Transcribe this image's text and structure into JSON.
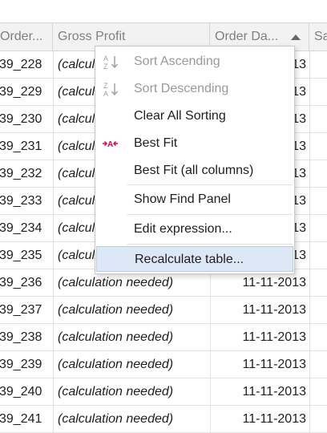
{
  "columns": {
    "col1": "Order...",
    "col2": "Gross Profit",
    "col3": "Order Da...",
    "col4": "Sa"
  },
  "rows": [
    {
      "id": "39_228",
      "gross": "(calculation needed)",
      "date": "11-11-2013"
    },
    {
      "id": "39_229",
      "gross": "(calculation needed)",
      "date": "11-11-2013"
    },
    {
      "id": "39_230",
      "gross": "(calculation needed)",
      "date": "11-11-2013"
    },
    {
      "id": "39_231",
      "gross": "(calculation needed)",
      "date": "11-11-2013"
    },
    {
      "id": "39_232",
      "gross": "(calculation needed)",
      "date": "11-11-2013"
    },
    {
      "id": "39_233",
      "gross": "(calculation needed)",
      "date": "11-11-2013"
    },
    {
      "id": "39_234",
      "gross": "(calculation needed)",
      "date": "11-11-2013"
    },
    {
      "id": "39_235",
      "gross": "(calculation needed)",
      "date": "11-11-2013"
    },
    {
      "id": "39_236",
      "gross": "(calculation needed)",
      "date": "11-11-2013"
    },
    {
      "id": "39_237",
      "gross": "(calculation needed)",
      "date": "11-11-2013"
    },
    {
      "id": "39_238",
      "gross": "(calculation needed)",
      "date": "11-11-2013"
    },
    {
      "id": "39_239",
      "gross": "(calculation needed)",
      "date": "11-11-2013"
    },
    {
      "id": "39_240",
      "gross": "(calculation needed)",
      "date": "11-11-2013"
    },
    {
      "id": "39_241",
      "gross": "(calculation needed)",
      "date": "11-11-2013"
    }
  ],
  "menu": {
    "sort_asc": "Sort Ascending",
    "sort_desc": "Sort Descending",
    "clear_sorting": "Clear All Sorting",
    "best_fit": "Best Fit",
    "best_fit_all": "Best Fit (all columns)",
    "show_find": "Show Find Panel",
    "edit_expression": "Edit expression...",
    "recalculate": "Recalculate table..."
  },
  "colors": {
    "hover_bg": "#dde8f6",
    "disabled_text": "#9a9a9a",
    "best_fit_icon": "#e0004d"
  }
}
